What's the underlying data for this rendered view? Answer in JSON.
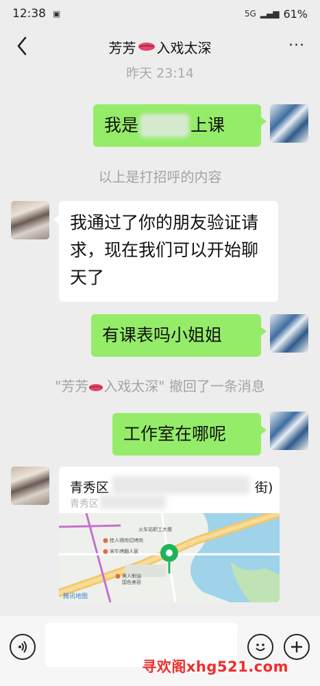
{
  "status_bar": {
    "time": "12:38",
    "network": "5G",
    "battery": "61%"
  },
  "header": {
    "title_before": "芳芳",
    "title_after": "入戏太深",
    "more": "···"
  },
  "chat": {
    "timestamp": "昨天 23:14",
    "msg1_prefix": "我是",
    "msg1_suffix": "上课",
    "system1": "以上是打招呼的内容",
    "msg2": "我通过了你的朋友验证请求，现在我们可以开始聊天了",
    "msg3": "有课表吗小姐姐",
    "system2_before": "\"芳芳",
    "system2_after": "入戏太深\" 撤回了一条消息",
    "msg4": "工作室在哪呢",
    "location": {
      "title_prefix": "青秀区",
      "title_suffix": "街)",
      "subtitle_prefix": "青秀区",
      "map_labels": [
        "火车站职工大楼",
        "桂人得肉切烤肉",
        "宋牛烤翻人家",
        "美人制油",
        "国色美容",
        "腾讯地图"
      ]
    }
  },
  "watermark": "寻欢阁xhg521.com",
  "colors": {
    "sent_bubble": "#95ec69",
    "received_bubble": "#ffffff",
    "background": "#ededed",
    "watermark": "#ee2d2d"
  }
}
